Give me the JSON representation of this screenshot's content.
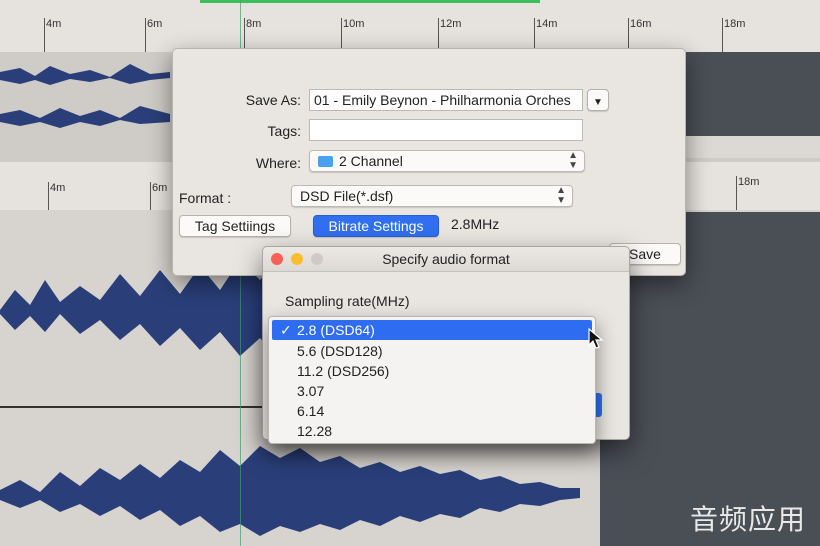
{
  "ruler_top": [
    "4m",
    "6m",
    "8m",
    "10m",
    "12m",
    "14m",
    "16m",
    "18m"
  ],
  "ruler_mid": [
    "4m",
    "6m",
    "18m"
  ],
  "save_dialog": {
    "save_as_label": "Save As:",
    "save_as_value": "01 - Emily Beynon - Philharmonia Orches",
    "tags_label": "Tags:",
    "tags_value": "",
    "where_label": "Where:",
    "where_value": "2 Channel",
    "format_label": "Format :",
    "format_value": "DSD File(*.dsf)",
    "tag_settings_button": "Tag Settiings",
    "bitrate_settings_button": "Bitrate Settings",
    "bitrate_value": "2.8MHz",
    "save_button": "Save"
  },
  "format_window": {
    "title": "Specify audio format",
    "sampling_rate_label": "Sampling rate(MHz)",
    "options": [
      "2.8 (DSD64)",
      "5.6 (DSD128)",
      "11.2 (DSD256)",
      "3.07",
      "6.14",
      "12.28"
    ],
    "selected_index": 0,
    "check_glyph": "✓"
  },
  "watermark": "音频应用",
  "colors": {
    "accent": "#2f6ff0",
    "waveform": "#2a3f7a",
    "close": "#fc5f57",
    "minimize": "#fdbc2e",
    "zoom": "#cfcac4"
  }
}
